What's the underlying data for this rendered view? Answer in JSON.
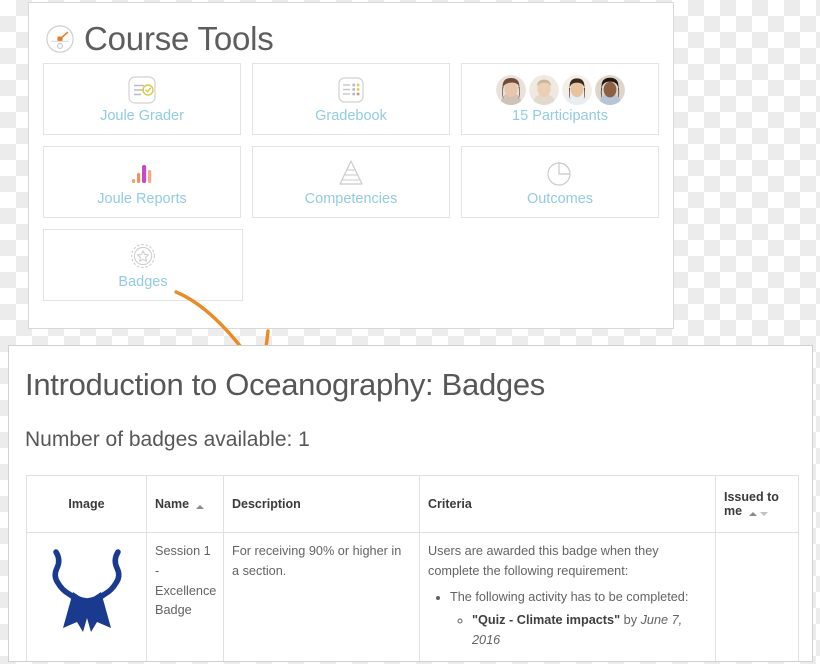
{
  "course_tools": {
    "title": "Course Tools",
    "header_icon": "gauge-icon",
    "tiles": [
      {
        "label": "Joule Grader",
        "icon": "checklist-icon"
      },
      {
        "label": "Gradebook",
        "icon": "gradebook-grid-icon"
      },
      {
        "label": "15 Participants",
        "icon": "participant-avatars-icon"
      },
      {
        "label": "Joule Reports",
        "icon": "bar-chart-icon"
      },
      {
        "label": "Competencies",
        "icon": "pyramid-icon"
      },
      {
        "label": "Outcomes",
        "icon": "pie-chart-icon"
      },
      {
        "label": "Badges",
        "icon": "badge-seal-icon"
      }
    ],
    "link_color": "#93cbe3",
    "title_color": "#5d5d5d"
  },
  "annotation": {
    "arrow_color": "#eb8b23",
    "arrow_name": "orange-annotation-arrow"
  },
  "badges_page": {
    "title": "Introduction to Oceanography: Badges",
    "badge_count_text": "Number of badges available: 1",
    "table": {
      "headers": {
        "image": "Image",
        "name": "Name",
        "description": "Description",
        "criteria": "Criteria",
        "issued_to_me": "Issued to me"
      },
      "rows": [
        {
          "image_alt": "blue-ribbon-badge",
          "name": "Session 1 - Excellence Badge",
          "description": "For receiving 90% or higher in a section.",
          "criteria_intro": "Users are awarded this badge when they complete the following requirement:",
          "criteria_bullet": "The following activity has to be completed:",
          "criteria_quiz": "\"Quiz - Climate impacts\"",
          "criteria_by": "by",
          "criteria_date": "June 7, 2016",
          "issued_to_me": ""
        }
      ]
    },
    "badge_color": "#1a3a8f",
    "text_color": "#575757"
  }
}
